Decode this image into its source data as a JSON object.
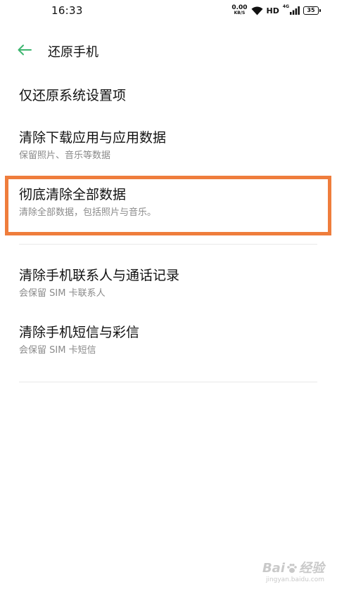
{
  "status_bar": {
    "time": "16:33",
    "net_speed_value": "0.00",
    "net_speed_unit": "KB/S",
    "hd": "HD",
    "net_type": "4G",
    "battery": "35"
  },
  "header": {
    "title": "还原手机",
    "back_icon": "arrow-left-icon",
    "accent_color": "#3db56f"
  },
  "options": [
    {
      "title": "仅还原系统设置项",
      "subtitle": ""
    },
    {
      "title": "清除下载应用与应用数据",
      "subtitle": "保留照片、音乐等数据"
    },
    {
      "title": "彻底清除全部数据",
      "subtitle": "清除全部数据，包括照片与音乐。"
    },
    {
      "title": "清除手机联系人与通话记录",
      "subtitle": "会保留 SIM 卡联系人"
    },
    {
      "title": "清除手机短信与彩信",
      "subtitle": "会保留 SIM 卡短信"
    }
  ],
  "highlight": {
    "color": "#ef7d3c",
    "target_option": 2
  },
  "watermark": {
    "logo_text": "Bai",
    "logo_suffix": "经验",
    "site": "jingyan.baidu.com"
  }
}
